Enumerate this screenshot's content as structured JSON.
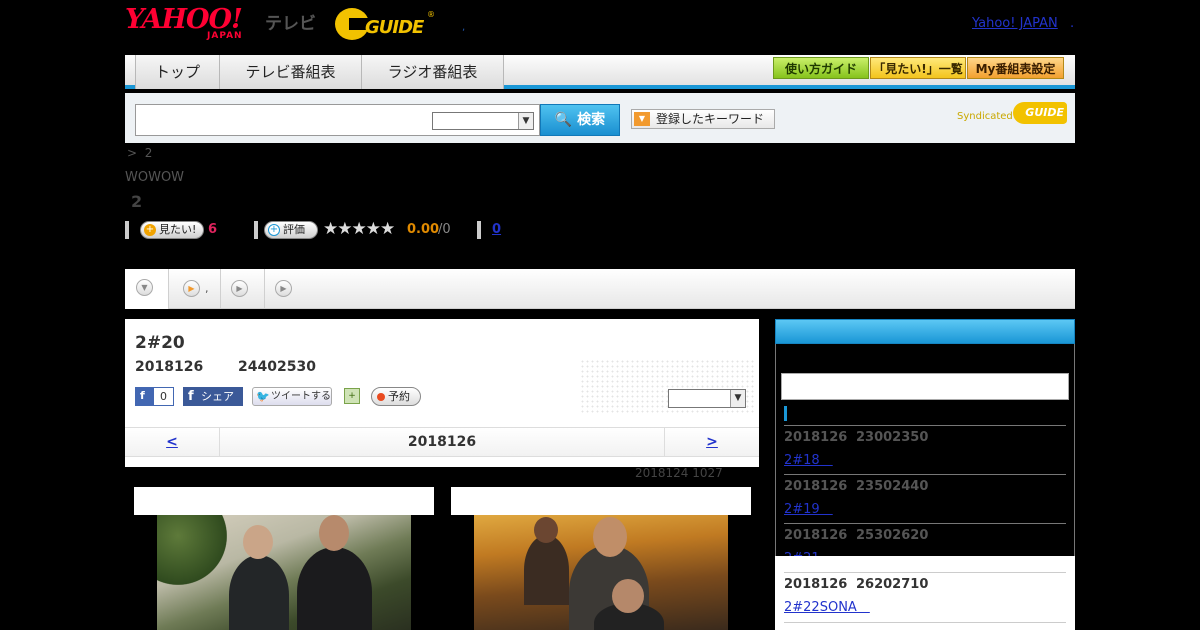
{
  "header": {
    "yahoo_logo_text": "YAHOO!",
    "yahoo_logo_sub": "JAPAN",
    "tv_label": "テレビ",
    "gguide_logo_text": "GUIDE",
    "gguide_mark": "®",
    "separator": ",",
    "yahoo_japan_link": "Yahoo! JAPAN",
    "yahoo_japan_link_suffix": "."
  },
  "nav": {
    "tabs": [
      {
        "label": "トップ"
      },
      {
        "label": "テレビ番組表"
      },
      {
        "label": "ラジオ番組表"
      }
    ],
    "guide_button": "使い方ガイド",
    "mitai_button": "「見たい!」一覧",
    "my_button": "My番組表設定"
  },
  "search": {
    "input_value": "",
    "select_value": "",
    "search_button": "検索",
    "keyword_button": "登録したキーワード",
    "syndicated_label": "Syndicated",
    "syndicated_logo": "GUIDE"
  },
  "program": {
    "breadcrumb_sep": ">",
    "breadcrumb_item": "2",
    "channel": "WOWOW",
    "title": "2",
    "mitai_label": "見たい!",
    "mitai_count": "6",
    "rating_label": "評価",
    "stars": "★★★★★",
    "score": "0.00",
    "score_count": "/0",
    "link_count": "0"
  },
  "tabstrip": {
    "tab2_text": ","
  },
  "episode": {
    "title": "2#20",
    "date": "2018126",
    "time": "24402530",
    "fb_like_count": "0",
    "fb_share_label": "シェア",
    "tweet_label": "ツイートする",
    "reserve_label": "予約",
    "select_value": "",
    "prev": "<",
    "current": "2018126",
    "next": ">",
    "updated": "2018124  1027"
  },
  "side": {
    "items": [
      {
        "date": "2018126",
        "time": "23002350",
        "link": "2#18　"
      },
      {
        "date": "2018126",
        "time": "23502440",
        "link": "2#19　"
      },
      {
        "date": "2018126",
        "time": "25302620",
        "link": "2#21　"
      },
      {
        "date": "2018126",
        "time": "26202710",
        "link": "2#22SONA　"
      }
    ]
  },
  "colors": {
    "accent_blue": "#1a97d6",
    "yahoo_red": "#ff0033",
    "gguide_yellow": "#f2c200",
    "link_blue": "#2233cc",
    "mitai_pink": "#e0245e",
    "score_orange": "#e08a00"
  }
}
